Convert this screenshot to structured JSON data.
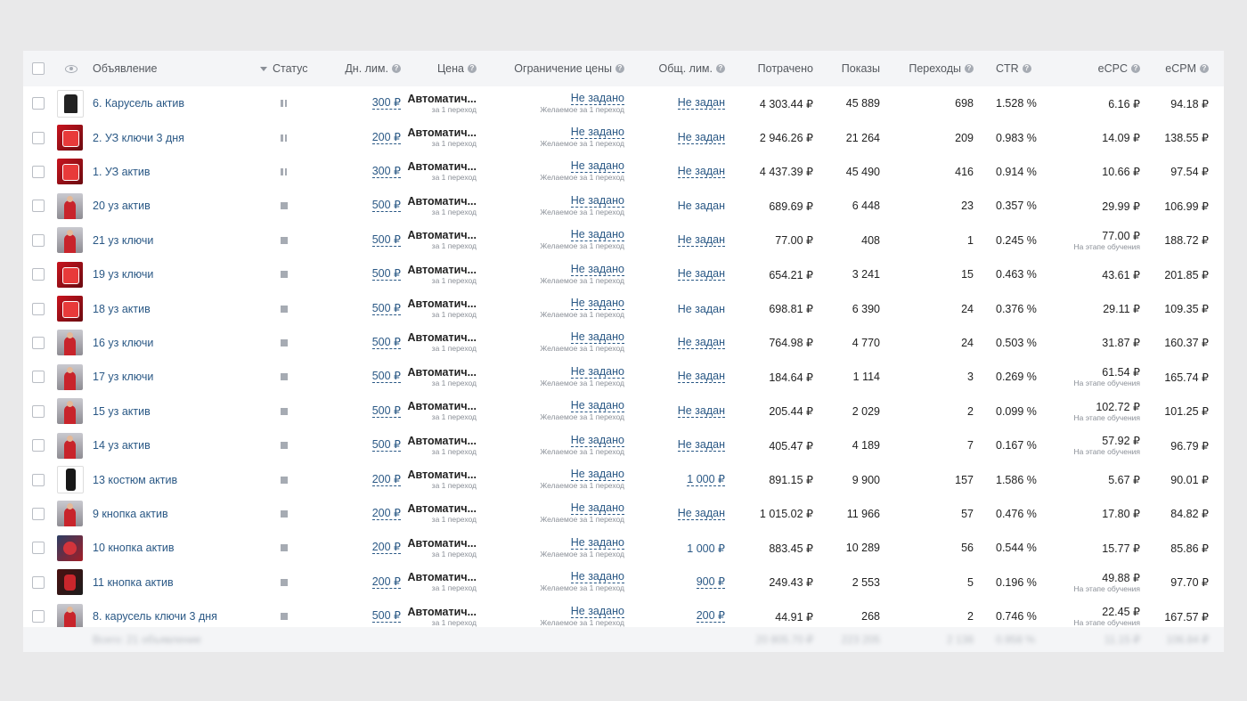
{
  "header": {
    "ad": "Объявление",
    "status": "Статус",
    "daily_limit": "Дн. лим.",
    "price": "Цена",
    "price_limit": "Ограничение цены",
    "total_limit": "Общ. лим.",
    "spent": "Потрачено",
    "impressions": "Показы",
    "clicks": "Переходы",
    "ctr": "CTR",
    "ecpc": "eCPC",
    "ecpm": "eCPM"
  },
  "labels": {
    "price_main": "Автоматич...",
    "price_sub": "за 1 переход",
    "limit_main": "Не задано",
    "limit_sub": "Желаемое за 1 переход",
    "learning": "На этапе обучения"
  },
  "colors": {
    "link": "#2a5885",
    "header_bg": "#f4f5f7",
    "page_bg": "#e9e9ea"
  },
  "rows": [
    {
      "thumb": "black",
      "name": "6. Карусель актив",
      "status": "paused",
      "daily": "300 ₽",
      "total": "Не задан",
      "total_dashed": true,
      "spent": "4 303.44 ₽",
      "imps": "45 889",
      "clicks": "698",
      "ctr": "1.528 %",
      "ecpc": "6.16 ₽",
      "ecpc_learning": false,
      "ecpm": "94.18 ₽"
    },
    {
      "thumb": "red",
      "name": "2. УЗ ключи 3 дня",
      "status": "paused",
      "daily": "200 ₽",
      "total": "Не задан",
      "total_dashed": true,
      "spent": "2 946.26 ₽",
      "imps": "21 264",
      "clicks": "209",
      "ctr": "0.983 %",
      "ecpc": "14.09 ₽",
      "ecpc_learning": false,
      "ecpm": "138.55 ₽"
    },
    {
      "thumb": "red",
      "name": "1. УЗ актив",
      "status": "paused",
      "daily": "300 ₽",
      "total": "Не задан",
      "total_dashed": true,
      "spent": "4 437.39 ₽",
      "imps": "45 490",
      "clicks": "416",
      "ctr": "0.914 %",
      "ecpc": "10.66 ₽",
      "ecpc_learning": false,
      "ecpm": "97.54 ₽"
    },
    {
      "thumb": "man",
      "name": "20 уз актив",
      "status": "stopped",
      "daily": "500 ₽",
      "total": "Не задан",
      "total_dashed": false,
      "spent": "689.69 ₽",
      "imps": "6 448",
      "clicks": "23",
      "ctr": "0.357 %",
      "ecpc": "29.99 ₽",
      "ecpc_learning": false,
      "ecpm": "106.99 ₽"
    },
    {
      "thumb": "man",
      "name": "21 уз ключи",
      "status": "stopped",
      "daily": "500 ₽",
      "total": "Не задан",
      "total_dashed": true,
      "spent": "77.00 ₽",
      "imps": "408",
      "clicks": "1",
      "ctr": "0.245 %",
      "ecpc": "77.00 ₽",
      "ecpc_learning": true,
      "ecpm": "188.72 ₽"
    },
    {
      "thumb": "red",
      "name": "19 уз ключи",
      "status": "stopped",
      "daily": "500 ₽",
      "total": "Не задан",
      "total_dashed": true,
      "spent": "654.21 ₽",
      "imps": "3 241",
      "clicks": "15",
      "ctr": "0.463 %",
      "ecpc": "43.61 ₽",
      "ecpc_learning": false,
      "ecpm": "201.85 ₽"
    },
    {
      "thumb": "red",
      "name": "18 уз актив",
      "status": "stopped",
      "daily": "500 ₽",
      "total": "Не задан",
      "total_dashed": false,
      "spent": "698.81 ₽",
      "imps": "6 390",
      "clicks": "24",
      "ctr": "0.376 %",
      "ecpc": "29.11 ₽",
      "ecpc_learning": false,
      "ecpm": "109.35 ₽"
    },
    {
      "thumb": "man",
      "name": "16 уз ключи",
      "status": "stopped",
      "daily": "500 ₽",
      "total": "Не задан",
      "total_dashed": true,
      "spent": "764.98 ₽",
      "imps": "4 770",
      "clicks": "24",
      "ctr": "0.503 %",
      "ecpc": "31.87 ₽",
      "ecpc_learning": false,
      "ecpm": "160.37 ₽"
    },
    {
      "thumb": "man",
      "name": "17 уз ключи",
      "status": "stopped",
      "daily": "500 ₽",
      "total": "Не задан",
      "total_dashed": true,
      "spent": "184.64 ₽",
      "imps": "1 114",
      "clicks": "3",
      "ctr": "0.269 %",
      "ecpc": "61.54 ₽",
      "ecpc_learning": true,
      "ecpm": "165.74 ₽"
    },
    {
      "thumb": "man",
      "name": "15 уз актив",
      "status": "stopped",
      "daily": "500 ₽",
      "total": "Не задан",
      "total_dashed": true,
      "spent": "205.44 ₽",
      "imps": "2 029",
      "clicks": "2",
      "ctr": "0.099 %",
      "ecpc": "102.72 ₽",
      "ecpc_learning": true,
      "ecpm": "101.25 ₽"
    },
    {
      "thumb": "man",
      "name": "14 уз актив",
      "status": "stopped",
      "daily": "500 ₽",
      "total": "Не задан",
      "total_dashed": true,
      "spent": "405.47 ₽",
      "imps": "4 189",
      "clicks": "7",
      "ctr": "0.167 %",
      "ecpc": "57.92 ₽",
      "ecpc_learning": true,
      "ecpm": "96.79 ₽"
    },
    {
      "thumb": "suit",
      "name": "13 костюм актив",
      "status": "stopped",
      "daily": "200 ₽",
      "total": "1 000 ₽",
      "total_dashed": true,
      "spent": "891.15 ₽",
      "imps": "9 900",
      "clicks": "157",
      "ctr": "1.586 %",
      "ecpc": "5.67 ₽",
      "ecpc_learning": false,
      "ecpm": "90.01 ₽"
    },
    {
      "thumb": "man",
      "name": "9 кнопка актив",
      "status": "stopped",
      "daily": "200 ₽",
      "total": "Не задан",
      "total_dashed": true,
      "spent": "1 015.02 ₽",
      "imps": "11 966",
      "clicks": "57",
      "ctr": "0.476 %",
      "ecpc": "17.80 ₽",
      "ecpc_learning": false,
      "ecpm": "84.82 ₽"
    },
    {
      "thumb": "blue",
      "name": "10 кнопка актив",
      "status": "stopped",
      "daily": "200 ₽",
      "total": "1 000 ₽",
      "total_dashed": false,
      "spent": "883.45 ₽",
      "imps": "10 289",
      "clicks": "56",
      "ctr": "0.544 %",
      "ecpc": "15.77 ₽",
      "ecpc_learning": false,
      "ecpm": "85.86 ₽"
    },
    {
      "thumb": "dark",
      "name": "11 кнопка актив",
      "status": "stopped",
      "daily": "200 ₽",
      "total": "900 ₽",
      "total_dashed": true,
      "spent": "249.43 ₽",
      "imps": "2 553",
      "clicks": "5",
      "ctr": "0.196 %",
      "ecpc": "49.88 ₽",
      "ecpc_learning": true,
      "ecpm": "97.70 ₽"
    },
    {
      "thumb": "man",
      "name": "8. карусель ключи 3 дня",
      "status": "stopped",
      "daily": "500 ₽",
      "total": "200 ₽",
      "total_dashed": true,
      "spent": "44.91 ₽",
      "imps": "268",
      "clicks": "2",
      "ctr": "0.746 %",
      "ecpc": "22.45 ₽",
      "ecpc_learning": true,
      "ecpm": "167.57 ₽"
    }
  ],
  "footer": {
    "summary": "Всего: 21 объявление",
    "spent": "20 805.70 ₽",
    "imps": "223 205",
    "clicks": "2 138",
    "ctr": "0.958 %",
    "ecpc": "11.15 ₽",
    "ecpm": "106.84 ₽"
  }
}
